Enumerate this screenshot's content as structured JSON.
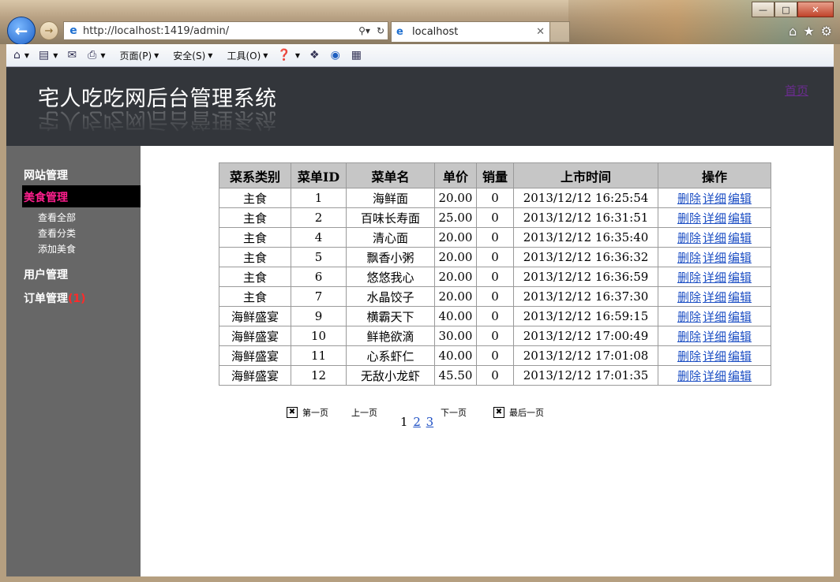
{
  "browser": {
    "address_url": "http://localhost:1419/admin/",
    "tab_title": "localhost",
    "commands": [
      "页面(P)",
      "安全(S)",
      "工具(O)"
    ]
  },
  "header": {
    "site_title": "宅人吃吃网后台管理系统",
    "home_link": "首页"
  },
  "sidebar": {
    "site_mgmt": "网站管理",
    "food_mgmt": "美食管理",
    "food_items": [
      "查看全部",
      "查看分类",
      "添加美食"
    ],
    "user_mgmt": "用户管理",
    "order_mgmt": "订单管理",
    "order_badge": "(1)"
  },
  "table": {
    "headers": [
      "菜系类别",
      "菜单ID",
      "菜单名",
      "单价",
      "销量",
      "上市时间",
      "操作"
    ],
    "actions": [
      "删除",
      "详细",
      "编辑"
    ],
    "rows": [
      [
        "主食",
        "1",
        "海鲜面",
        "20.00",
        "0",
        "2013/12/12 16:25:54"
      ],
      [
        "主食",
        "2",
        "百味长寿面",
        "25.00",
        "0",
        "2013/12/12 16:31:51"
      ],
      [
        "主食",
        "4",
        "清心面",
        "20.00",
        "0",
        "2013/12/12 16:35:40"
      ],
      [
        "主食",
        "5",
        "飘香小粥",
        "20.00",
        "0",
        "2013/12/12 16:36:32"
      ],
      [
        "主食",
        "6",
        "悠悠我心",
        "20.00",
        "0",
        "2013/12/12 16:36:59"
      ],
      [
        "主食",
        "7",
        "水晶饺子",
        "20.00",
        "0",
        "2013/12/12 16:37:30"
      ],
      [
        "海鲜盛宴",
        "9",
        "横霸天下",
        "40.00",
        "0",
        "2013/12/12 16:59:15"
      ],
      [
        "海鲜盛宴",
        "10",
        "鲜艳欲滴",
        "30.00",
        "0",
        "2013/12/12 17:00:49"
      ],
      [
        "海鲜盛宴",
        "11",
        "心系虾仁",
        "40.00",
        "0",
        "2013/12/12 17:01:08"
      ],
      [
        "海鲜盛宴",
        "12",
        "无敌小龙虾",
        "45.50",
        "0",
        "2013/12/12 17:01:35"
      ]
    ]
  },
  "pager": {
    "first": "第一页",
    "prev": "上一页",
    "next": "下一页",
    "last": "最后一页",
    "current": "1",
    "pages": [
      "2",
      "3"
    ]
  }
}
